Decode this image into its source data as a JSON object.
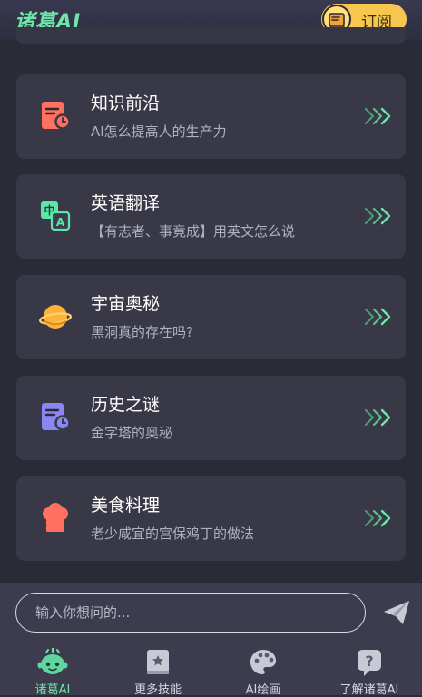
{
  "header": {
    "brand": "诸葛AI",
    "subscribe_label": "订阅"
  },
  "topics": [
    {
      "title": "知识前沿",
      "subtitle": "AI怎么提高人的生产力",
      "icon": "doc-clock-icon"
    },
    {
      "title": "英语翻译",
      "subtitle": "【有志者、事竟成】用英文怎么说",
      "icon": "translate-icon"
    },
    {
      "title": "宇宙奥秘",
      "subtitle": "黑洞真的存在吗?",
      "icon": "planet-icon"
    },
    {
      "title": "历史之谜",
      "subtitle": "金字塔的奥秘",
      "icon": "doc-clock-icon"
    },
    {
      "title": "美食料理",
      "subtitle": "老少咸宜的宫保鸡丁的做法",
      "icon": "chef-hat-icon"
    }
  ],
  "composer": {
    "placeholder": "输入你想问的..."
  },
  "tabs": [
    {
      "label": "诸葛AI",
      "active": true
    },
    {
      "label": "更多技能",
      "active": false
    },
    {
      "label": "AI绘画",
      "active": false
    },
    {
      "label": "了解诸葛AI",
      "active": false
    }
  ],
  "colors": {
    "accent_green": "#6ee6a8",
    "subscribe_yellow": "#f6c64f",
    "card_bg": "#383846",
    "page_bg": "#2b2b38"
  }
}
